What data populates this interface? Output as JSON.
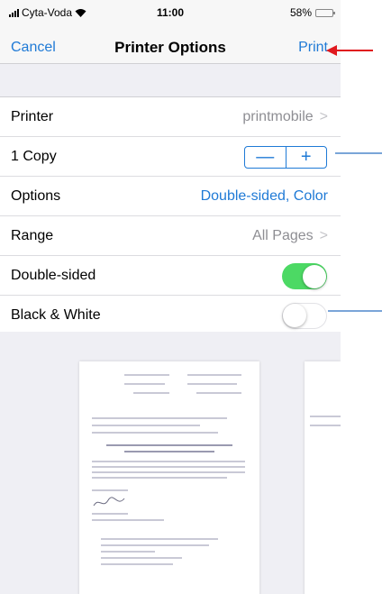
{
  "status_bar": {
    "carrier": "Cyta-Voda",
    "time": "11:00",
    "battery_percent": "58%",
    "battery_level": 0.58,
    "battery_color": "#f5c518"
  },
  "nav": {
    "cancel": "Cancel",
    "title": "Printer Options",
    "print": "Print"
  },
  "rows": {
    "printer": {
      "label": "Printer",
      "value": "printmobile"
    },
    "copies": {
      "label": "1 Copy",
      "minus": "—",
      "plus": "+"
    },
    "options": {
      "label": "Options",
      "value": "Double-sided, Color"
    },
    "range": {
      "label": "Range",
      "value": "All Pages"
    },
    "double_sided": {
      "label": "Double-sided",
      "on": true
    },
    "black_white": {
      "label": "Black & White",
      "on": false
    }
  },
  "colors": {
    "accent": "#1f7ad6",
    "toggle_on": "#4cd964",
    "annotation_red": "#e0191e",
    "annotation_blue": "#2a6fc0"
  }
}
